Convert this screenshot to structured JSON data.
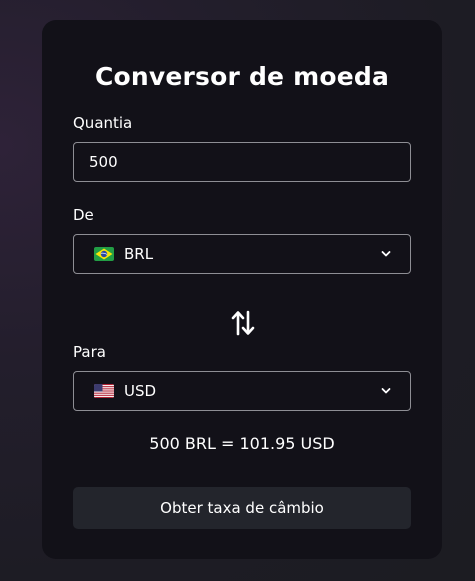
{
  "converter": {
    "title": "Conversor de moeda",
    "amount_label": "Quantia",
    "amount_value": "500",
    "from_label": "De",
    "from_currency": "BRL",
    "from_flag": "brazil-flag-icon",
    "to_label": "Para",
    "to_currency": "USD",
    "to_flag": "usa-flag-icon",
    "result": "500 BRL = 101.95 USD",
    "button_label": "Obter taxa de câmbio"
  },
  "colors": {
    "card_background": "#121118",
    "field_border": "#8e8e94",
    "button_background": "#23252c",
    "text": "#ffffff"
  }
}
